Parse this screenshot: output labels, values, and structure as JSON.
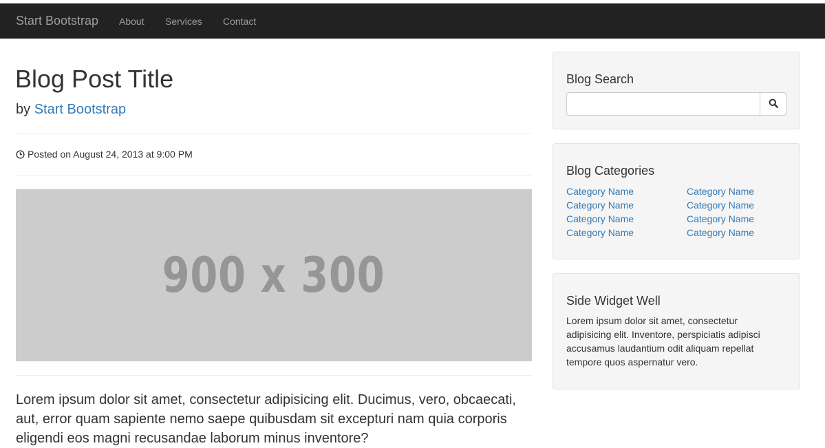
{
  "navbar": {
    "brand": "Start Bootstrap",
    "links": [
      {
        "label": "About"
      },
      {
        "label": "Services"
      },
      {
        "label": "Contact"
      }
    ]
  },
  "post": {
    "title": "Blog Post Title",
    "by_prefix": "by",
    "author": "Start Bootstrap",
    "posted": "Posted on August 24, 2013 at 9:00 PM",
    "image_label": "900 x 300",
    "lead": "Lorem ipsum dolor sit amet, consectetur adipisicing elit. Ducimus, vero, obcaecati, aut, error quam sapiente nemo saepe quibusdam sit excepturi nam quia corporis eligendi eos magni recusandae laborum minus inventore?"
  },
  "sidebar": {
    "search": {
      "title": "Blog Search",
      "value": "",
      "button_icon": "search-icon"
    },
    "categories": {
      "title": "Blog Categories",
      "left": [
        "Category Name",
        "Category Name",
        "Category Name",
        "Category Name"
      ],
      "right": [
        "Category Name",
        "Category Name",
        "Category Name",
        "Category Name"
      ]
    },
    "widget": {
      "title": "Side Widget Well",
      "text": "Lorem ipsum dolor sit amet, consectetur adipisicing elit. Inventore, perspiciatis adipisci accusamus laudantium odit aliquam repellat tempore quos aspernatur vero."
    }
  },
  "colors": {
    "navbar_bg": "#222222",
    "nav_text": "#9d9d9d",
    "link": "#337ab7",
    "well_bg": "#f5f5f5",
    "placeholder_bg": "#cccccc"
  }
}
